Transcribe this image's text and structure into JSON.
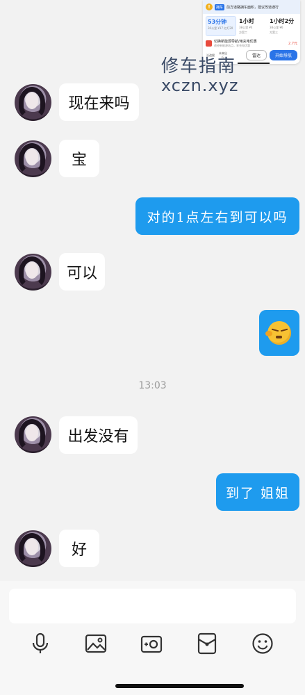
{
  "nav_card": {
    "alert_tag": "拥车",
    "alert_text": "前方道路拥车面积，建议改道通行",
    "routes": [
      {
        "time": "53分钟",
        "sub": "30公里 ¥17 红灯20",
        "active": true
      },
      {
        "time": "1小时",
        "sub": "38公里 ¥4",
        "sub2": "方案二",
        "active": false
      },
      {
        "time": "1小时2分",
        "sub": "38公里 ¥6",
        "sub2": "方案三",
        "active": false
      }
    ],
    "charge_title": "切换新能源导航/用充电优惠",
    "charge_sub": "途经新能源站点，享充电优惠",
    "charge_price": "2.7元",
    "mini_1": "沿途搜",
    "mini_2": "未来出行",
    "btn_radar": "雷达",
    "btn_start": "开始导航"
  },
  "watermark": {
    "zh": "修车指南",
    "en": "xczn.xyz"
  },
  "messages": [
    {
      "dir": "in",
      "text": "现在来吗"
    },
    {
      "dir": "in",
      "text": "宝"
    },
    {
      "dir": "out",
      "text": "对的1点左右到可以吗"
    },
    {
      "dir": "in",
      "text": "可以"
    },
    {
      "dir": "out",
      "type": "emoji",
      "emoji": "sleepy-face"
    },
    {
      "dir": "in",
      "text": "出发没有"
    },
    {
      "dir": "out",
      "text": "到了 姐姐"
    },
    {
      "dir": "in",
      "text": "好"
    }
  ],
  "timestamp": "13:03",
  "composer": {
    "placeholder": "",
    "tools": [
      "microphone-icon",
      "image-icon",
      "camera-icon",
      "red-envelope-icon",
      "emoji-icon"
    ]
  },
  "colors": {
    "outgoing_bubble": "#1e9bee",
    "incoming_bubble": "#ffffff",
    "background": "#f2f2f2"
  }
}
